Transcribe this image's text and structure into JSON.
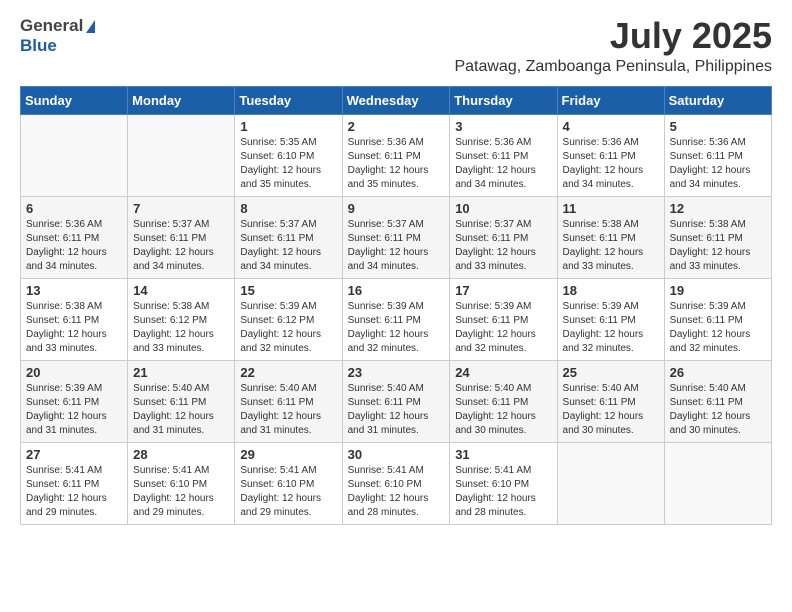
{
  "header": {
    "logo_general": "General",
    "logo_blue": "Blue",
    "month": "July 2025",
    "location": "Patawag, Zamboanga Peninsula, Philippines"
  },
  "weekdays": [
    "Sunday",
    "Monday",
    "Tuesday",
    "Wednesday",
    "Thursday",
    "Friday",
    "Saturday"
  ],
  "weeks": [
    [
      {
        "day": "",
        "info": ""
      },
      {
        "day": "",
        "info": ""
      },
      {
        "day": "1",
        "info": "Sunrise: 5:35 AM\nSunset: 6:10 PM\nDaylight: 12 hours and 35 minutes."
      },
      {
        "day": "2",
        "info": "Sunrise: 5:36 AM\nSunset: 6:11 PM\nDaylight: 12 hours and 35 minutes."
      },
      {
        "day": "3",
        "info": "Sunrise: 5:36 AM\nSunset: 6:11 PM\nDaylight: 12 hours and 34 minutes."
      },
      {
        "day": "4",
        "info": "Sunrise: 5:36 AM\nSunset: 6:11 PM\nDaylight: 12 hours and 34 minutes."
      },
      {
        "day": "5",
        "info": "Sunrise: 5:36 AM\nSunset: 6:11 PM\nDaylight: 12 hours and 34 minutes."
      }
    ],
    [
      {
        "day": "6",
        "info": "Sunrise: 5:36 AM\nSunset: 6:11 PM\nDaylight: 12 hours and 34 minutes."
      },
      {
        "day": "7",
        "info": "Sunrise: 5:37 AM\nSunset: 6:11 PM\nDaylight: 12 hours and 34 minutes."
      },
      {
        "day": "8",
        "info": "Sunrise: 5:37 AM\nSunset: 6:11 PM\nDaylight: 12 hours and 34 minutes."
      },
      {
        "day": "9",
        "info": "Sunrise: 5:37 AM\nSunset: 6:11 PM\nDaylight: 12 hours and 34 minutes."
      },
      {
        "day": "10",
        "info": "Sunrise: 5:37 AM\nSunset: 6:11 PM\nDaylight: 12 hours and 33 minutes."
      },
      {
        "day": "11",
        "info": "Sunrise: 5:38 AM\nSunset: 6:11 PM\nDaylight: 12 hours and 33 minutes."
      },
      {
        "day": "12",
        "info": "Sunrise: 5:38 AM\nSunset: 6:11 PM\nDaylight: 12 hours and 33 minutes."
      }
    ],
    [
      {
        "day": "13",
        "info": "Sunrise: 5:38 AM\nSunset: 6:11 PM\nDaylight: 12 hours and 33 minutes."
      },
      {
        "day": "14",
        "info": "Sunrise: 5:38 AM\nSunset: 6:12 PM\nDaylight: 12 hours and 33 minutes."
      },
      {
        "day": "15",
        "info": "Sunrise: 5:39 AM\nSunset: 6:12 PM\nDaylight: 12 hours and 32 minutes."
      },
      {
        "day": "16",
        "info": "Sunrise: 5:39 AM\nSunset: 6:11 PM\nDaylight: 12 hours and 32 minutes."
      },
      {
        "day": "17",
        "info": "Sunrise: 5:39 AM\nSunset: 6:11 PM\nDaylight: 12 hours and 32 minutes."
      },
      {
        "day": "18",
        "info": "Sunrise: 5:39 AM\nSunset: 6:11 PM\nDaylight: 12 hours and 32 minutes."
      },
      {
        "day": "19",
        "info": "Sunrise: 5:39 AM\nSunset: 6:11 PM\nDaylight: 12 hours and 32 minutes."
      }
    ],
    [
      {
        "day": "20",
        "info": "Sunrise: 5:39 AM\nSunset: 6:11 PM\nDaylight: 12 hours and 31 minutes."
      },
      {
        "day": "21",
        "info": "Sunrise: 5:40 AM\nSunset: 6:11 PM\nDaylight: 12 hours and 31 minutes."
      },
      {
        "day": "22",
        "info": "Sunrise: 5:40 AM\nSunset: 6:11 PM\nDaylight: 12 hours and 31 minutes."
      },
      {
        "day": "23",
        "info": "Sunrise: 5:40 AM\nSunset: 6:11 PM\nDaylight: 12 hours and 31 minutes."
      },
      {
        "day": "24",
        "info": "Sunrise: 5:40 AM\nSunset: 6:11 PM\nDaylight: 12 hours and 30 minutes."
      },
      {
        "day": "25",
        "info": "Sunrise: 5:40 AM\nSunset: 6:11 PM\nDaylight: 12 hours and 30 minutes."
      },
      {
        "day": "26",
        "info": "Sunrise: 5:40 AM\nSunset: 6:11 PM\nDaylight: 12 hours and 30 minutes."
      }
    ],
    [
      {
        "day": "27",
        "info": "Sunrise: 5:41 AM\nSunset: 6:11 PM\nDaylight: 12 hours and 29 minutes."
      },
      {
        "day": "28",
        "info": "Sunrise: 5:41 AM\nSunset: 6:10 PM\nDaylight: 12 hours and 29 minutes."
      },
      {
        "day": "29",
        "info": "Sunrise: 5:41 AM\nSunset: 6:10 PM\nDaylight: 12 hours and 29 minutes."
      },
      {
        "day": "30",
        "info": "Sunrise: 5:41 AM\nSunset: 6:10 PM\nDaylight: 12 hours and 28 minutes."
      },
      {
        "day": "31",
        "info": "Sunrise: 5:41 AM\nSunset: 6:10 PM\nDaylight: 12 hours and 28 minutes."
      },
      {
        "day": "",
        "info": ""
      },
      {
        "day": "",
        "info": ""
      }
    ]
  ]
}
